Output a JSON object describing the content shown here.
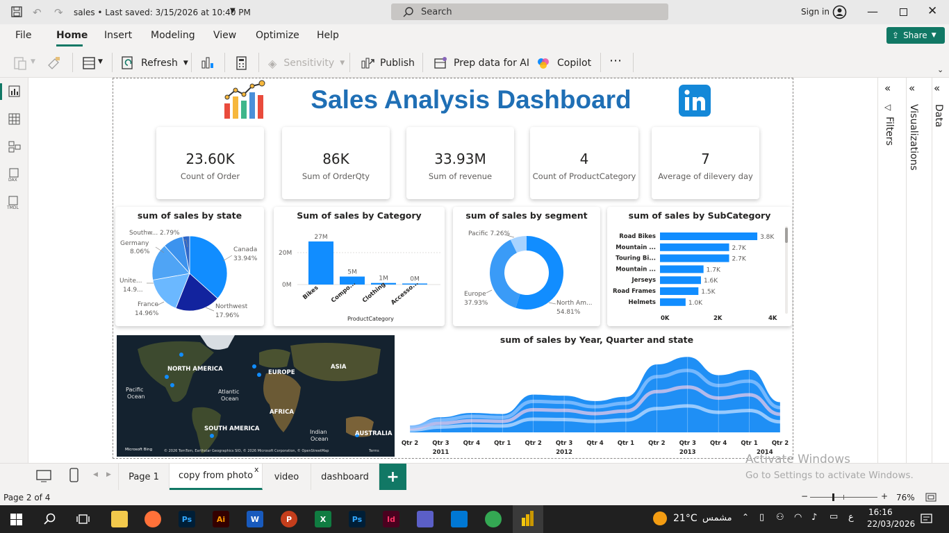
{
  "app": {
    "title": "sales • Last saved: 3/15/2026 at 10:40 PM",
    "search_label": "Search",
    "signin_label": "Sign in"
  },
  "menu": {
    "items": [
      "File",
      "Home",
      "Insert",
      "Modeling",
      "View",
      "Optimize",
      "Help"
    ],
    "active": "Home",
    "share_label": "Share"
  },
  "ribbon": {
    "refresh": "Refresh",
    "sensitivity": "Sensitivity",
    "publish": "Publish",
    "prep_ai": "Prep data for AI",
    "copilot": "Copilot"
  },
  "dashboard": {
    "title": "Sales Analysis Dashboard",
    "kpis": [
      {
        "value": "23.60K",
        "label": "Count of Order"
      },
      {
        "value": "86K",
        "label": "Sum of OrderQty"
      },
      {
        "value": "33.93M",
        "label": "Sum of revenue"
      },
      {
        "value": "4",
        "label": "Count of ProductCategory"
      },
      {
        "value": "7",
        "label": "Average of dilevery day"
      }
    ]
  },
  "pie_state": {
    "title": "sum of sales by state",
    "labels": [
      "Southw...",
      "2.79%",
      "Germany",
      "8.06%",
      "Canada",
      "33.94%",
      "Unite...",
      "14.9...",
      "France",
      "14.96%",
      "Northwest",
      "17.96%"
    ]
  },
  "bar_category": {
    "title": "Sum of sales by Category",
    "xlabel": "ProductCategory",
    "yticks": [
      "20M",
      "0M"
    ],
    "data_labels": [
      "27M",
      "5M",
      "1M",
      "0M"
    ]
  },
  "donut_segment": {
    "title": "sum of sales by segment",
    "labels": [
      "Pacific 7.26%",
      "Europe",
      "37.93%",
      "North Am...",
      "54.81%"
    ]
  },
  "hbar_subcat": {
    "title": "sum of sales by SubCategory",
    "xticks": [
      "0K",
      "2K",
      "4K"
    ]
  },
  "map": {
    "labels": [
      "NORTH AMERICA",
      "EUROPE",
      "ASIA",
      "Pacific",
      "Ocean",
      "Atlantic",
      "Ocean",
      "AFRICA",
      "SOUTH AMERICA",
      "Indian",
      "Ocean",
      "AUSTRALIA"
    ],
    "attribution": "© 2026 TomTom, Earthstar Geographics SIO, © 2026 Microsoft Corporation, © OpenStreetMap",
    "terms": "Terms",
    "bing": "Microsoft Bing"
  },
  "ribbon_chart": {
    "title": "sum of sales by Year, Quarter and state",
    "quarters": [
      "Qtr 2",
      "Qtr 3",
      "Qtr 4",
      "Qtr 1",
      "Qtr 2",
      "Qtr 3",
      "Qtr 4",
      "Qtr 1",
      "Qtr 2",
      "Qtr 3",
      "Qtr 4",
      "Qtr 1",
      "Qtr 2"
    ],
    "years": [
      "2011",
      "2012",
      "2013",
      "2014"
    ]
  },
  "panes": {
    "filters": "Filters",
    "visualizations": "Visualizations",
    "data": "Data"
  },
  "pages": {
    "tabs": [
      "Page 1",
      "copy from photo",
      "video",
      "dashboard"
    ],
    "active": "copy from photo"
  },
  "status": {
    "page_info": "Page 2 of 4",
    "zoom": "76%",
    "watermark_title": "Activate Windows",
    "watermark_sub": "Go to Settings to activate Windows."
  },
  "taskbar": {
    "weather": "21°C",
    "weather_text": "مشمس",
    "lang": "ع",
    "time": "16:16",
    "date": "22/03/2026"
  },
  "chart_data": [
    {
      "type": "pie",
      "title": "sum of sales by state",
      "categories": [
        "Canada",
        "Northwest",
        "France",
        "Unite...",
        "Germany",
        "Southw..."
      ],
      "values": [
        33.94,
        17.96,
        14.96,
        14.9,
        8.06,
        2.79
      ],
      "colors": [
        "#118DFF",
        "#12239E",
        "#6BB8FF",
        "#4FA4F5",
        "#3C93EE",
        "#2F68C9"
      ]
    },
    {
      "type": "bar",
      "title": "Sum of sales by Category",
      "categories": [
        "Bikes",
        "Compo...",
        "Clothing",
        "Accesso..."
      ],
      "values": [
        27,
        5,
        1,
        0
      ],
      "units": "M",
      "xlabel": "ProductCategory",
      "ylim": [
        0,
        30
      ]
    },
    {
      "type": "pie",
      "title": "sum of sales by segment",
      "categories": [
        "North Am...",
        "Europe",
        "Pacific"
      ],
      "values": [
        54.81,
        37.93,
        7.26
      ],
      "colors": [
        "#118DFF",
        "#3A9BF7",
        "#A8D3FF"
      ]
    },
    {
      "type": "bar",
      "title": "sum of sales by SubCategory",
      "categories": [
        "Road Bikes",
        "Mountain ...",
        "Touring Bi...",
        "Mountain ...",
        "Jerseys",
        "Road Frames",
        "Helmets"
      ],
      "values": [
        3.8,
        2.7,
        2.7,
        1.7,
        1.6,
        1.5,
        1.0
      ],
      "data_labels": [
        "3.8K",
        "2.7K",
        "2.7K",
        "1.7K",
        "1.6K",
        "1.5K",
        "1.0K"
      ],
      "units": "K",
      "xlim": [
        0,
        4
      ]
    },
    {
      "type": "area",
      "title": "sum of sales by Year, Quarter and state",
      "x": [
        "2011 Qtr 2",
        "2011 Qtr 3",
        "2011 Qtr 4",
        "2012 Qtr 1",
        "2012 Qtr 2",
        "2012 Qtr 3",
        "2012 Qtr 4",
        "2013 Qtr 1",
        "2013 Qtr 2",
        "2013 Qtr 3",
        "2013 Qtr 4",
        "2014 Qtr 1",
        "2014 Qtr 2"
      ],
      "series": [
        {
          "values": [
            0.6,
            1.4,
            1.8,
            1.7,
            3.5,
            3.4,
            2.9,
            3.3,
            6.3,
            7.0,
            5.3,
            5.8,
            2.8
          ]
        }
      ]
    }
  ]
}
